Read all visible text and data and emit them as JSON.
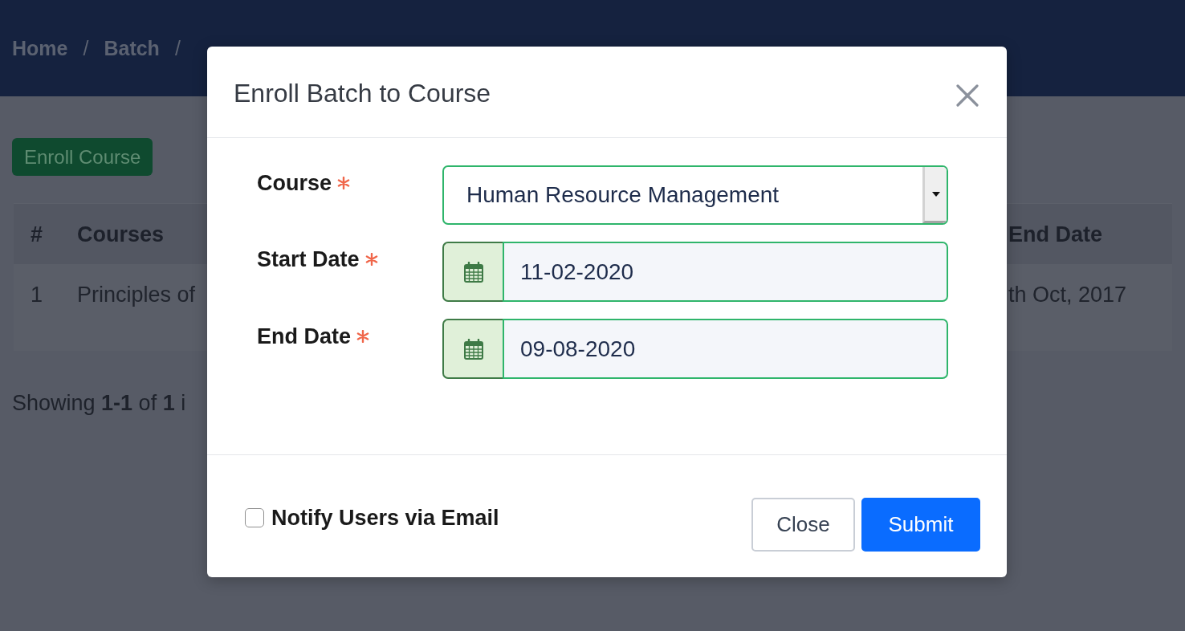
{
  "navbar": {
    "breadcrumb": [
      {
        "label": "Home",
        "separator": "/"
      },
      {
        "label": "Batch",
        "separator": "/"
      }
    ]
  },
  "page": {
    "enroll_button": "Enroll Course",
    "table": {
      "columns": [
        "#",
        "Courses",
        "End Date"
      ],
      "rows": [
        {
          "cells": [
            "1",
            "Principles of",
            "th Oct, 2017"
          ]
        }
      ]
    },
    "summary": "Showing **1-1** of **1** i"
  },
  "modal": {
    "title": "Enroll Batch to Course",
    "fields": [
      {
        "kind": "select",
        "label": "Course",
        "required": true,
        "value": "Human Resource Management"
      },
      {
        "kind": "date",
        "label": "Start Date",
        "required": true,
        "value": "11-02-2020"
      },
      {
        "kind": "date",
        "label": "End Date",
        "required": true,
        "value": "09-08-2020"
      }
    ],
    "notify": {
      "label": "Notify Users via Email",
      "checked": false
    },
    "buttons": [
      {
        "label": "Close",
        "kind": "secondary"
      },
      {
        "label": "Submit",
        "kind": "primary"
      }
    ]
  }
}
